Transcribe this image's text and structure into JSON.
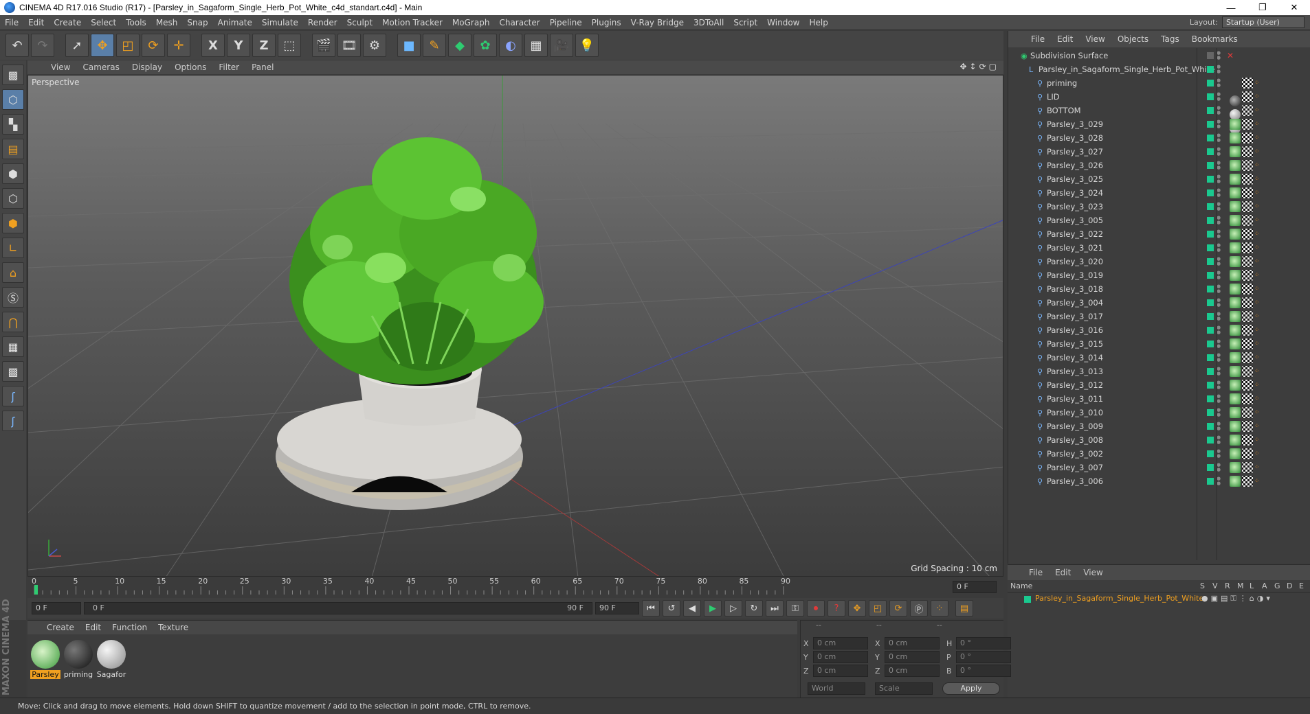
{
  "window": {
    "title": "CINEMA 4D R17.016 Studio (R17) - [Parsley_in_Sagaform_Single_Herb_Pot_White_c4d_standart.c4d] - Main",
    "controls": [
      "—",
      "❐",
      "✕"
    ]
  },
  "menubar": {
    "items": [
      "File",
      "Edit",
      "Create",
      "Select",
      "Tools",
      "Mesh",
      "Snap",
      "Animate",
      "Simulate",
      "Render",
      "Sculpt",
      "Motion Tracker",
      "MoGraph",
      "Character",
      "Pipeline",
      "Plugins",
      "V-Ray Bridge",
      "3DToAll",
      "Script",
      "Window",
      "Help"
    ],
    "layout_label": "Layout:",
    "layout_value": "Startup (User)"
  },
  "toolbar": {
    "axis_x": "X",
    "axis_y": "Y",
    "axis_z": "Z"
  },
  "viewport": {
    "menu": [
      "View",
      "Cameras",
      "Display",
      "Options",
      "Filter",
      "Panel"
    ],
    "label": "Perspective",
    "grid_spacing": "Grid Spacing : 10 cm",
    "nav_glyphs": "✥↕⟳▢"
  },
  "object_manager": {
    "menu": [
      "File",
      "Edit",
      "View",
      "Objects",
      "Tags",
      "Bookmarks"
    ],
    "objects": [
      {
        "name": "Subdivision Surface",
        "level": 0,
        "tag": "none"
      },
      {
        "name": "Parsley_in_Sagaform_Single_Herb_Pot_White",
        "level": 1,
        "tag": "none"
      },
      {
        "name": "priming",
        "level": 2,
        "tag": "black"
      },
      {
        "name": "LID",
        "level": 2,
        "tag": "white"
      },
      {
        "name": "BOTTOM",
        "level": 2,
        "tag": "white"
      },
      {
        "name": "Parsley_3_029",
        "level": 2,
        "tag": "green"
      },
      {
        "name": "Parsley_3_028",
        "level": 2,
        "tag": "green"
      },
      {
        "name": "Parsley_3_027",
        "level": 2,
        "tag": "green"
      },
      {
        "name": "Parsley_3_026",
        "level": 2,
        "tag": "green"
      },
      {
        "name": "Parsley_3_025",
        "level": 2,
        "tag": "green"
      },
      {
        "name": "Parsley_3_024",
        "level": 2,
        "tag": "green"
      },
      {
        "name": "Parsley_3_023",
        "level": 2,
        "tag": "green"
      },
      {
        "name": "Parsley_3_005",
        "level": 2,
        "tag": "green"
      },
      {
        "name": "Parsley_3_022",
        "level": 2,
        "tag": "green"
      },
      {
        "name": "Parsley_3_021",
        "level": 2,
        "tag": "green"
      },
      {
        "name": "Parsley_3_020",
        "level": 2,
        "tag": "green"
      },
      {
        "name": "Parsley_3_019",
        "level": 2,
        "tag": "green"
      },
      {
        "name": "Parsley_3_018",
        "level": 2,
        "tag": "green"
      },
      {
        "name": "Parsley_3_004",
        "level": 2,
        "tag": "green"
      },
      {
        "name": "Parsley_3_017",
        "level": 2,
        "tag": "green"
      },
      {
        "name": "Parsley_3_016",
        "level": 2,
        "tag": "green"
      },
      {
        "name": "Parsley_3_015",
        "level": 2,
        "tag": "green"
      },
      {
        "name": "Parsley_3_014",
        "level": 2,
        "tag": "green"
      },
      {
        "name": "Parsley_3_013",
        "level": 2,
        "tag": "green"
      },
      {
        "name": "Parsley_3_012",
        "level": 2,
        "tag": "green"
      },
      {
        "name": "Parsley_3_011",
        "level": 2,
        "tag": "green"
      },
      {
        "name": "Parsley_3_010",
        "level": 2,
        "tag": "green"
      },
      {
        "name": "Parsley_3_009",
        "level": 2,
        "tag": "green"
      },
      {
        "name": "Parsley_3_008",
        "level": 2,
        "tag": "green"
      },
      {
        "name": "Parsley_3_002",
        "level": 2,
        "tag": "green"
      },
      {
        "name": "Parsley_3_007",
        "level": 2,
        "tag": "green"
      },
      {
        "name": "Parsley_3_006",
        "level": 2,
        "tag": "green"
      }
    ]
  },
  "attribute_manager": {
    "menu": [
      "File",
      "Edit",
      "View"
    ],
    "col_name": "Name",
    "col_flags": [
      "S",
      "V",
      "R",
      "M",
      "L",
      "A",
      "G",
      "D",
      "E"
    ],
    "item": "Parsley_in_Sagaform_Single_Herb_Pot_White"
  },
  "timeline": {
    "ticks": [
      "0",
      "5",
      "10",
      "15",
      "20",
      "25",
      "30",
      "35",
      "40",
      "45",
      "50",
      "55",
      "60",
      "65",
      "70",
      "75",
      "80",
      "85",
      "90"
    ],
    "current_frame": "0 F",
    "start_frame": "0 F",
    "slider_start": "0 F",
    "slider_end": "90 F",
    "end_frame": "90 F"
  },
  "material_manager": {
    "menu": [
      "Create",
      "Edit",
      "Function",
      "Texture"
    ],
    "materials": [
      {
        "label": "Parsley",
        "selected": true
      },
      {
        "label": "priming",
        "selected": false
      },
      {
        "label": "Sagafor",
        "selected": false
      }
    ]
  },
  "coordinates": {
    "header": [
      "--",
      "--",
      "--"
    ],
    "rows": [
      {
        "a": "X",
        "av": "0 cm",
        "b": "X",
        "bv": "0 cm",
        "c": "H",
        "cv": "0 °"
      },
      {
        "a": "Y",
        "av": "0 cm",
        "b": "Y",
        "bv": "0 cm",
        "c": "P",
        "cv": "0 °"
      },
      {
        "a": "Z",
        "av": "0 cm",
        "b": "Z",
        "bv": "0 cm",
        "c": "B",
        "cv": "0 °"
      }
    ],
    "world": "World",
    "scale": "Scale",
    "apply": "Apply"
  },
  "brand": "MAXON CINEMA 4D",
  "status": "Move: Click and drag to move elements. Hold down SHIFT to quantize movement / add to the selection in point mode, CTRL to remove."
}
